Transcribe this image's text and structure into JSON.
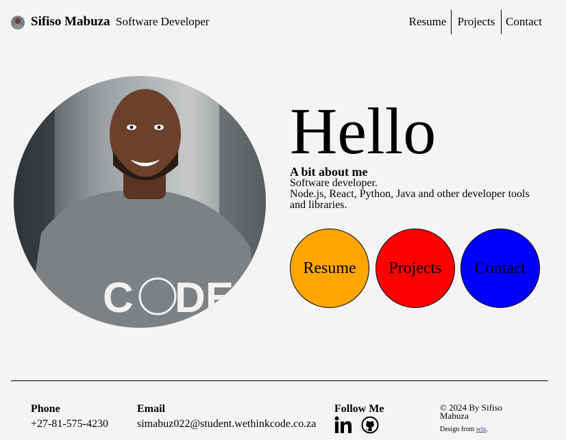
{
  "header": {
    "name": "Sifiso Mabuza",
    "tagline": "Software Developer",
    "nav": [
      "Resume",
      "Projects",
      "Contact"
    ]
  },
  "hero": {
    "greeting": "Hello",
    "about_title": "A bit about me",
    "about_line1": "Software developer.",
    "about_line2": "Node.js, React, Python, Java and other developer tools and libraries.",
    "buttons": [
      {
        "label": "Resume",
        "color": "#ffa500"
      },
      {
        "label": "Projects",
        "color": "#ff0000"
      },
      {
        "label": "Contact",
        "color": "#0000ff"
      }
    ]
  },
  "footer": {
    "phone_label": "Phone",
    "phone_value": "+27-81-575-4230",
    "email_label": "Email",
    "email_value": "simabuz022@student.wethinkcode.co.za",
    "follow_label": "Follow Me",
    "social_icons": [
      "linkedin-icon",
      "github-icon"
    ],
    "copyright": "© 2024 By Sifiso Mabuza",
    "design_prefix": "Design from ",
    "design_link": "wix",
    "design_suffix": "."
  }
}
